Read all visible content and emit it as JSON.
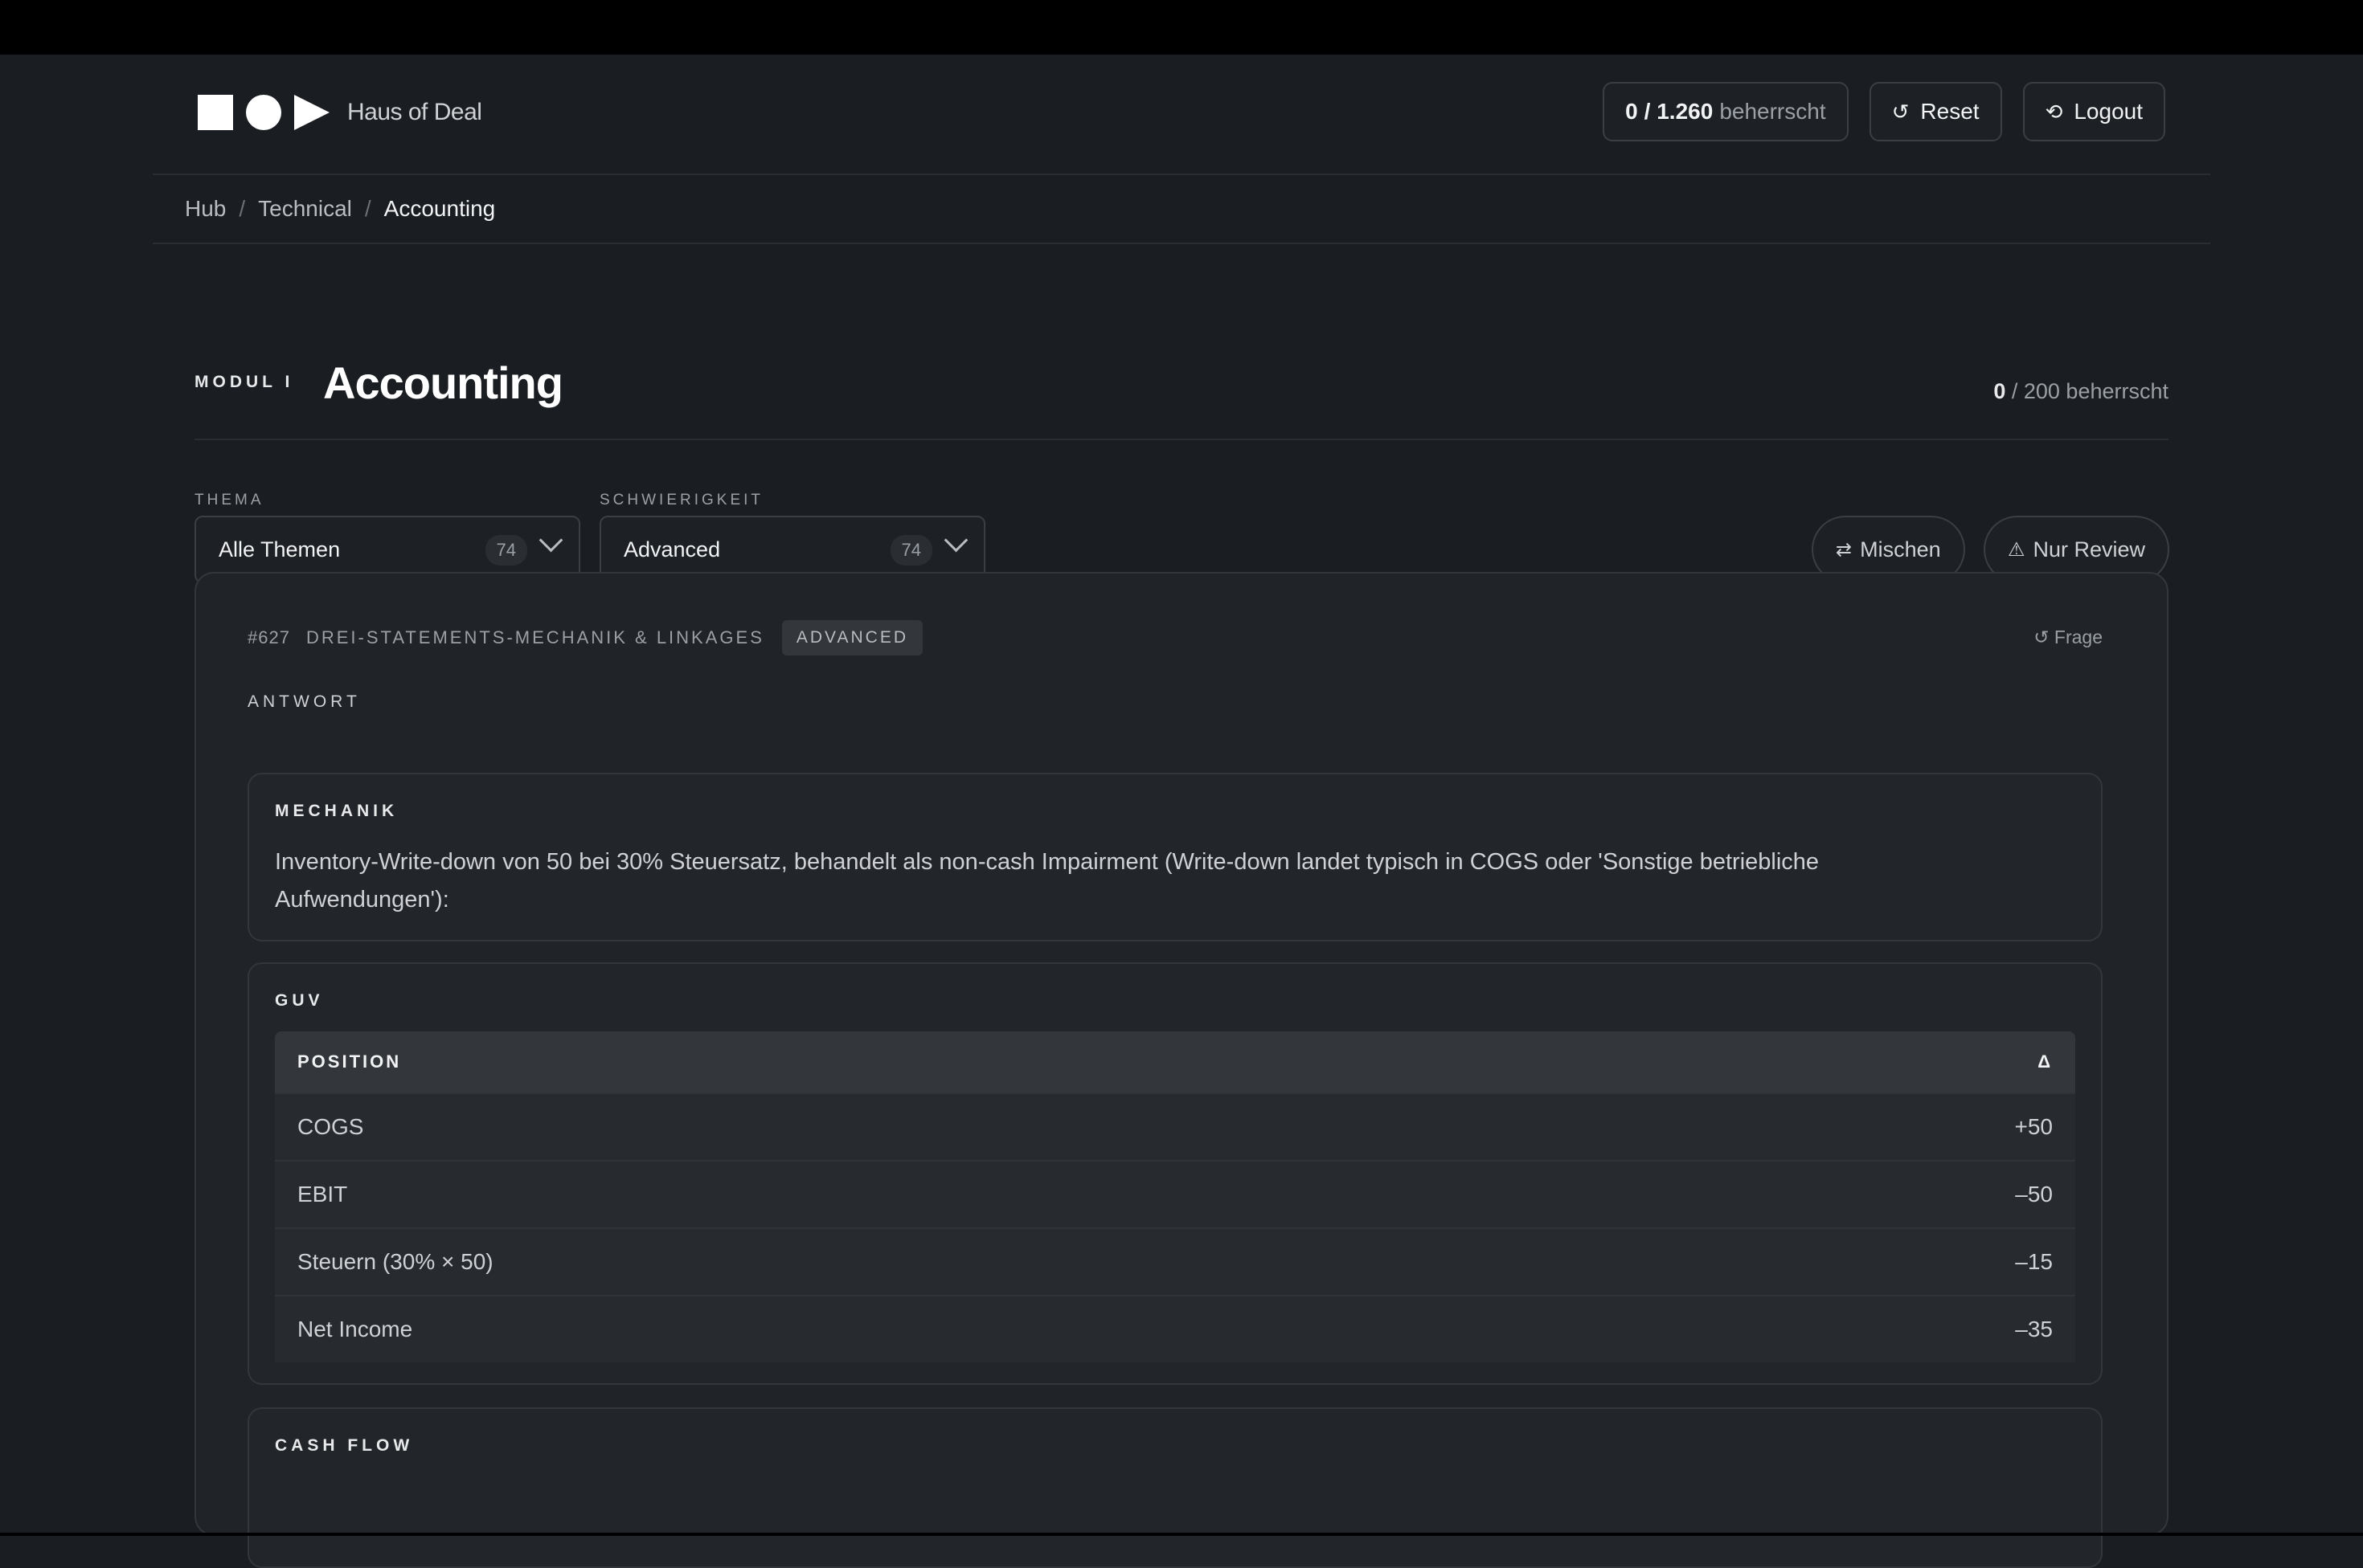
{
  "brand": {
    "name": "Haus of Deal"
  },
  "header": {
    "progress_done": "0",
    "progress_total": "/ 1.260",
    "progress_suffix": "beherrscht",
    "reset_label": "Reset",
    "logout_label": "Logout"
  },
  "breadcrumb": {
    "hub": "Hub",
    "technical": "Technical",
    "current": "Accounting",
    "separator": "/"
  },
  "module": {
    "label": "MODUL I",
    "title": "Accounting",
    "count_done": "0",
    "count_rest": "/ 200 beherrscht"
  },
  "filters": {
    "thema_label": "THEMA",
    "thema_value": "Alle Themen",
    "thema_count": "74",
    "schwierigkeit_label": "SCHWIERIGKEIT",
    "schwierigkeit_value": "Advanced",
    "schwierigkeit_count": "74",
    "mischen_label": "Mischen",
    "review_label": "Nur Review"
  },
  "card": {
    "number": "#627",
    "topic": "DREI-STATEMENTS-MECHANIK & LINKAGES",
    "badge": "ADVANCED",
    "frage_label": "Frage",
    "antwort_label": "ANTWORT",
    "mechanik": {
      "label": "MECHANIK",
      "text": "Inventory-Write-down von 50 bei 30% Steuersatz, behandelt als non-cash Impairment (Write-down landet typisch in COGS oder 'Sonstige betriebliche Aufwendungen'):"
    },
    "guv": {
      "label": "GUV",
      "col_position": "POSITION",
      "col_delta": "Δ",
      "rows": [
        {
          "position": "COGS",
          "delta": "+50"
        },
        {
          "position": "EBIT",
          "delta": "–50"
        },
        {
          "position": "Steuern (30% × 50)",
          "delta": "–15"
        },
        {
          "position": "Net Income",
          "delta": "–35"
        }
      ]
    },
    "cashflow": {
      "label": "CASH FLOW"
    }
  },
  "icons": {
    "reset": "reset-icon",
    "logout": "logout-icon",
    "shuffle": "shuffle-icon",
    "warning": "warning-icon",
    "chevron": "chevron-down-icon"
  }
}
